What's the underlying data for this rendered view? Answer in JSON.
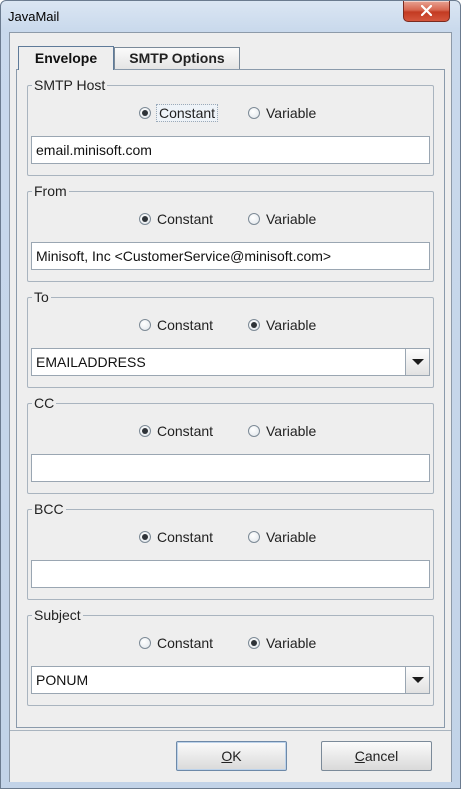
{
  "window": {
    "title": "JavaMail"
  },
  "tabs": [
    {
      "label": "Envelope",
      "active": true
    },
    {
      "label": "SMTP Options",
      "active": false
    }
  ],
  "radio_labels": {
    "constant": "Constant",
    "variable": "Variable"
  },
  "groups": {
    "smtp_host": {
      "legend": "SMTP Host",
      "selected": "Constant",
      "value": "email.minisoft.com",
      "field_type": "text"
    },
    "from": {
      "legend": "From",
      "selected": "Constant",
      "value": "Minisoft, Inc <CustomerService@minisoft.com>",
      "field_type": "text"
    },
    "to": {
      "legend": "To",
      "selected": "Variable",
      "value": "EMAILADDRESS",
      "field_type": "combo"
    },
    "cc": {
      "legend": "CC",
      "selected": "Constant",
      "value": "",
      "field_type": "text"
    },
    "bcc": {
      "legend": "BCC",
      "selected": "Constant",
      "value": "",
      "field_type": "text"
    },
    "subject": {
      "legend": "Subject",
      "selected": "Variable",
      "value": "PONUM",
      "field_type": "combo"
    }
  },
  "buttons": {
    "ok": {
      "mnemonic": "O",
      "rest": "K"
    },
    "cancel": {
      "mnemonic": "C",
      "rest": "ancel"
    }
  },
  "icons": {
    "close": "close-x-icon",
    "dropdown": "chevron-down-icon"
  }
}
